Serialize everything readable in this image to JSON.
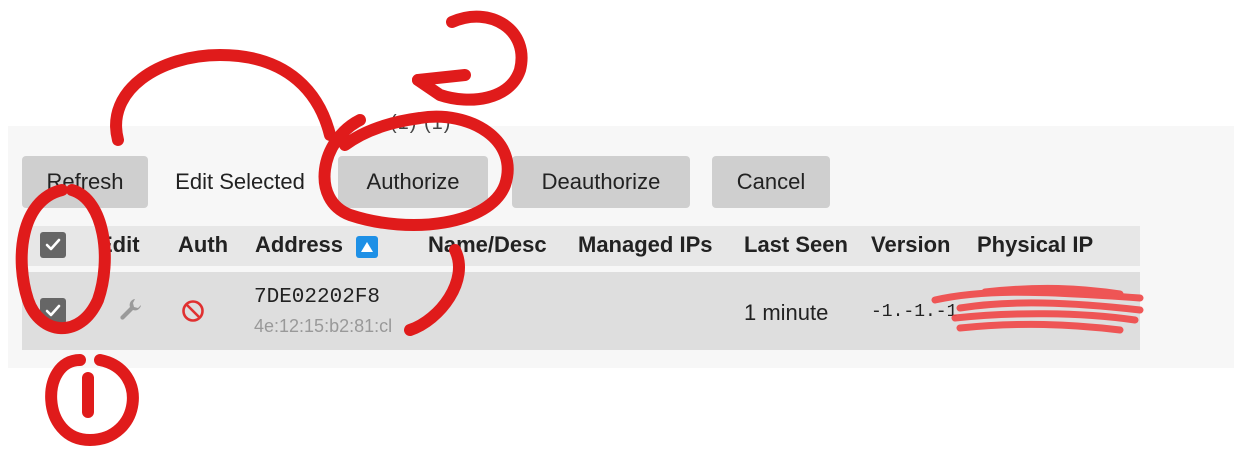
{
  "top_partial_text": "(1)    (1)",
  "toolbar": {
    "refresh_label": "Refresh",
    "edit_selected_label": "Edit Selected",
    "authorize_label": "Authorize",
    "deauthorize_label": "Deauthorize",
    "cancel_label": "Cancel"
  },
  "table": {
    "headers": {
      "edit": "Edit",
      "auth": "Auth",
      "address": "Address",
      "name_desc": "Name/Desc",
      "managed_ips": "Managed IPs",
      "last_seen": "Last Seen",
      "version": "Version",
      "physical_ip": "Physical IP"
    },
    "row": {
      "address": "7DE02202F8",
      "mac": "4e:12:15:b2:81:cl",
      "last_seen": "1 minute",
      "version": "-1.-1.-1"
    }
  },
  "annotations": {
    "label_1": "1",
    "label_2": "2",
    "color": "#e01b1b"
  },
  "colors": {
    "button_bg": "#cfcfcf",
    "sort_icon": "#1e90e6",
    "deny_icon": "#e03030"
  }
}
